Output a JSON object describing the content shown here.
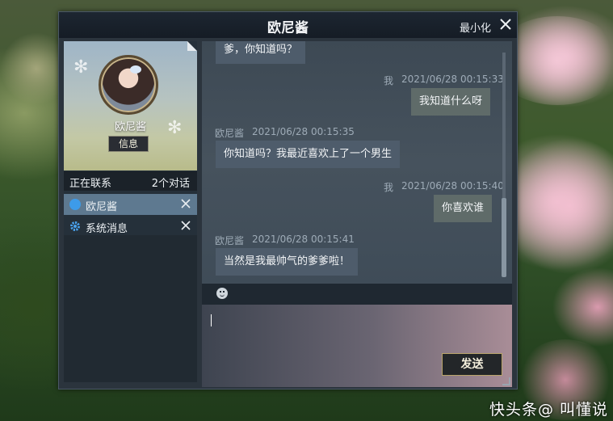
{
  "window": {
    "title": "欧尼酱",
    "minimize_label": "最小化"
  },
  "profile": {
    "name": "欧尼酱",
    "info_button": "信息"
  },
  "contacts": {
    "header_left": "正在联系",
    "header_right": "2个对话",
    "items": [
      {
        "label": "欧尼酱",
        "icon": "chat-bubble-icon",
        "active": true
      },
      {
        "label": "系统消息",
        "icon": "gear-icon",
        "active": false
      }
    ]
  },
  "messages": [
    {
      "side": "in",
      "sender": "",
      "time": "",
      "text": "爹，你知道吗？",
      "partial": true
    },
    {
      "side": "out",
      "sender": "我",
      "time": "2021/06/28  00:15:33",
      "text": "我知道什么呀"
    },
    {
      "side": "in",
      "sender": "欧尼酱",
      "time": "2021/06/28  00:15:35",
      "text": "你知道吗？我最近喜欢上了一个男生"
    },
    {
      "side": "out",
      "sender": "我",
      "time": "2021/06/28  00:15:40",
      "text": "你喜欢谁"
    },
    {
      "side": "in",
      "sender": "欧尼酱",
      "time": "2021/06/28  00:15:41",
      "text": "当然是我最帅气的爹爹啦！"
    }
  ],
  "composer": {
    "send_label": "发送",
    "value": ""
  },
  "watermark": "快头条@ 叫懂说",
  "colors": {
    "window_bg": "#2b343d",
    "titlebar": "#151c25",
    "active_contact": "#5e7990",
    "send_border": "#b9a46a"
  }
}
